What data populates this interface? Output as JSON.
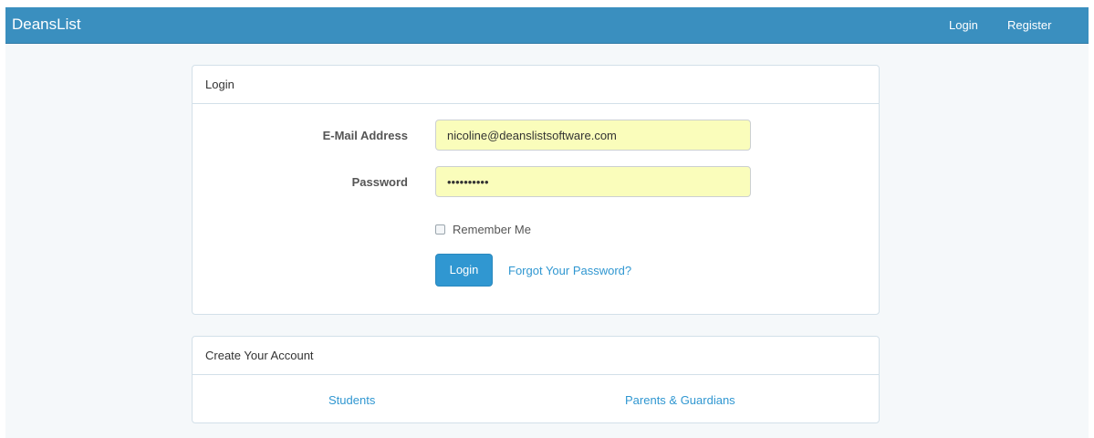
{
  "navbar": {
    "brand": "DeansList",
    "links": [
      {
        "label": "Login"
      },
      {
        "label": "Register"
      }
    ]
  },
  "login_panel": {
    "heading": "Login",
    "email_label": "E-Mail Address",
    "email_value": "nicoline@deanslistsoftware.com",
    "password_label": "Password",
    "password_value": "••••••••••",
    "remember_label": "Remember Me",
    "remember_checked": false,
    "login_button": "Login",
    "forgot_link": "Forgot Your Password?"
  },
  "create_panel": {
    "heading": "Create Your Account",
    "links": [
      {
        "label": "Students"
      },
      {
        "label": "Parents & Guardians"
      }
    ]
  },
  "colors": {
    "navbar_bg": "#3a8fbf",
    "accent": "#3097d1",
    "autofill_bg": "#fafdbb"
  }
}
